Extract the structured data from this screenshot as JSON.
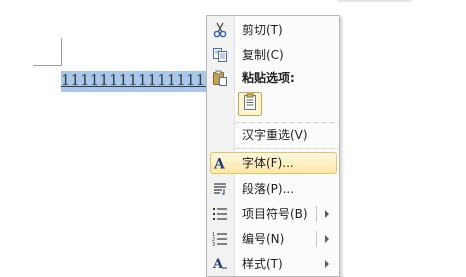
{
  "document": {
    "selected_text": "11111111111111111"
  },
  "menu": {
    "cut": "剪切(T)",
    "copy": "复制(C)",
    "paste_options": "粘贴选项:",
    "reconvert": "汉字重选(V)",
    "font": "字体(F)...",
    "paragraph": "段落(P)...",
    "bullets": "项目符号(B)",
    "numbering": "编号(N)",
    "styles": "样式(T)"
  },
  "colors": {
    "selection": "#a7c8ea",
    "menu_highlight": "#ffe8a6",
    "menu_highlight_border": "#e5c365"
  },
  "icons": {
    "cut": "scissors-icon",
    "copy": "copy-icon",
    "paste_options": "clipboard-icon",
    "paste_keep_text": "paste-text-only-icon",
    "font": "font-a-icon",
    "paragraph": "paragraph-icon",
    "bullets": "bullet-list-icon",
    "numbering": "numbered-list-icon",
    "styles": "styles-icon"
  }
}
